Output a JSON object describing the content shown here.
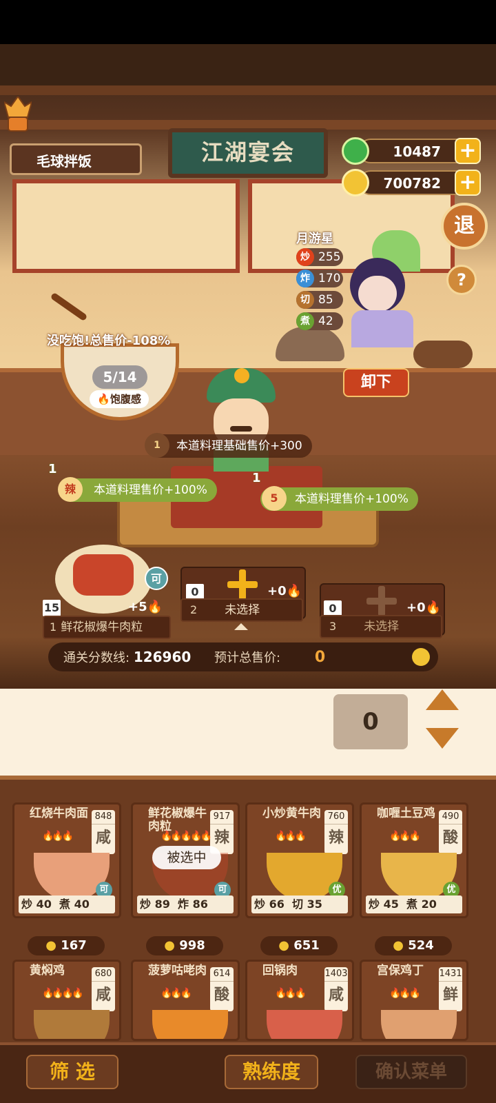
{
  "header": {
    "player_name": "毛球拌饭",
    "sign_text": "江湖宴会",
    "jade_amount": "10487",
    "coin_amount": "700782",
    "exit_label": "退",
    "help_label": "?"
  },
  "chef": {
    "name": "月游星",
    "stats": [
      {
        "glyph": "炒",
        "value": "255",
        "color": "#e0421c"
      },
      {
        "glyph": "炸",
        "value": "170",
        "color": "#3a8fd6"
      },
      {
        "glyph": "切",
        "value": "85",
        "color": "#b5722e"
      },
      {
        "glyph": "煮",
        "value": "42",
        "color": "#6aa232"
      }
    ],
    "unload_label": "卸下"
  },
  "fullness": {
    "note": "没吃饱!总售价-108%",
    "count": "5/14",
    "label": "饱腹感"
  },
  "buffs": {
    "base_price": {
      "num": "1",
      "text": "本道料理基础售价+300"
    },
    "spicy": {
      "num": "1",
      "icon": "辣",
      "text": "本道料理售价+100%"
    },
    "fire": {
      "num": "1",
      "icon": "5",
      "text": "本道料理售价+100%"
    }
  },
  "slots": [
    {
      "index": "1",
      "name": "鲜花椒爆牛肉粒",
      "count": "15",
      "heat": "+5",
      "badge": "可"
    },
    {
      "index": "2",
      "name": "未选择",
      "count": "0",
      "heat": "+0"
    },
    {
      "index": "3",
      "name": "未选择",
      "count": "0",
      "heat": "+0"
    }
  ],
  "score": {
    "pass_label": "通关分数线:",
    "pass_value": "126960",
    "total_label": "预计总售价:",
    "total_value": "0"
  },
  "quantity": "0",
  "dishes": [
    {
      "name": "红烧牛肉面",
      "price": "848",
      "flavor": "咸",
      "stat1": "炒",
      "v1": "40",
      "stat2": "煮",
      "v2": "40",
      "badge": "可",
      "sell": "167",
      "flames": "🔥🔥🔥",
      "dish_color": "#e8a07a"
    },
    {
      "name": "鲜花椒爆牛肉粒",
      "price": "917",
      "flavor": "辣",
      "stat1": "炒",
      "v1": "89",
      "stat2": "炸",
      "v2": "86",
      "badge": "可",
      "sell": "998",
      "flames": "🔥🔥🔥🔥🔥",
      "selected": "被选中",
      "dish_color": "#c9452a"
    },
    {
      "name": "小炒黄牛肉",
      "price": "760",
      "flavor": "辣",
      "stat1": "炒",
      "v1": "66",
      "stat2": "切",
      "v2": "35",
      "badge": "优",
      "sell": "651",
      "flames": "🔥🔥🔥",
      "dish_color": "#e3a82e"
    },
    {
      "name": "咖喱土豆鸡",
      "price": "490",
      "flavor": "酸",
      "stat1": "炒",
      "v1": "45",
      "stat2": "煮",
      "v2": "20",
      "badge": "优",
      "sell": "524",
      "flames": "🔥🔥🔥",
      "dish_color": "#e8b54a"
    },
    {
      "name": "黄焖鸡",
      "price": "680",
      "flavor": "咸",
      "flames": "🔥🔥🔥🔥",
      "dish_color": "#b07a3a"
    },
    {
      "name": "菠萝咕咾肉",
      "price": "614",
      "flavor": "酸",
      "flames": "🔥🔥🔥",
      "dish_color": "#e88a2a"
    },
    {
      "name": "回锅肉",
      "price": "1403",
      "flavor": "咸",
      "flames": "🔥🔥🔥",
      "dish_color": "#d8604a"
    },
    {
      "name": "宫保鸡丁",
      "price": "1431",
      "flavor": "鲜",
      "flames": "🔥🔥🔥",
      "dish_color": "#e0a070"
    }
  ],
  "bottom": {
    "filter_label": "筛 选",
    "proficiency_label": "熟练度",
    "confirm_label": "确认菜单"
  },
  "colors": {
    "accent_orange": "#f2b21a",
    "jade_green": "#3fb04a",
    "unload_red": "#c9421e",
    "buff_green": "#8aa83a"
  }
}
